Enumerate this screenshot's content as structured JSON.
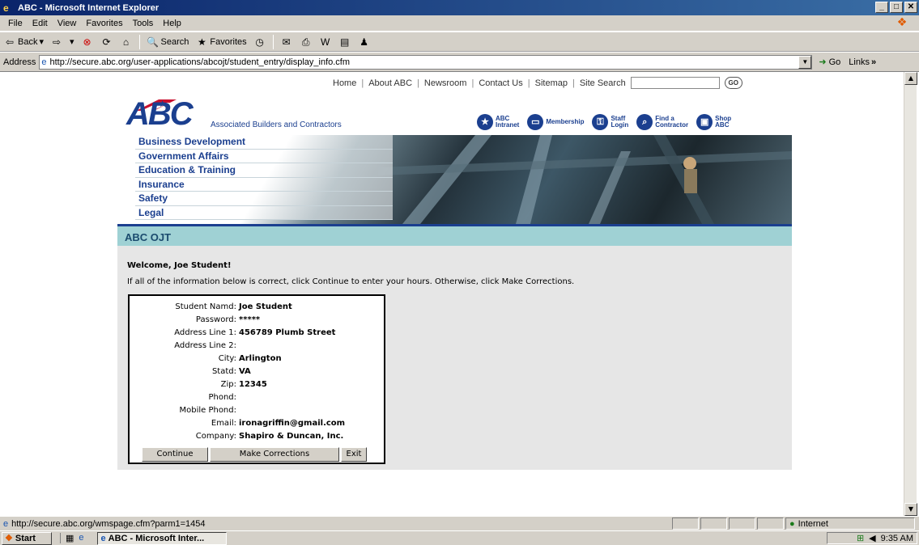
{
  "window": {
    "title": "ABC - Microsoft Internet Explorer",
    "min": "_",
    "max": "□",
    "close": "✕"
  },
  "menu": [
    "File",
    "Edit",
    "View",
    "Favorites",
    "Tools",
    "Help"
  ],
  "toolbar": {
    "back": "Back",
    "search": "Search",
    "favorites": "Favorites"
  },
  "address": {
    "label": "Address",
    "url": "http://secure.abc.org/user-applications/abcojt/student_entry/display_info.cfm",
    "go": "Go",
    "links": "Links"
  },
  "site": {
    "topnav": [
      "Home",
      "About ABC",
      "Newsroom",
      "Contact Us",
      "Sitemap",
      "Site Search"
    ],
    "separator": "|",
    "go_button": "GO",
    "logo": "ABC",
    "tagline": "Associated Builders and Contractors",
    "quicklinks": [
      {
        "line1": "ABC",
        "line2": "Intranet",
        "icon": "star-icon"
      },
      {
        "line1": "Membership",
        "line2": "",
        "icon": "membership-icon"
      },
      {
        "line1": "Staff",
        "line2": "Login",
        "icon": "login-icon"
      },
      {
        "line1": "Find a",
        "line2": "Contractor",
        "icon": "search-icon"
      },
      {
        "line1": "Shop",
        "line2": "ABC",
        "icon": "shop-icon"
      }
    ],
    "nav": [
      "Business Development",
      "Government Affairs",
      "Education & Training",
      "Insurance",
      "Safety",
      "Legal"
    ],
    "section_title": "ABC OJT"
  },
  "page": {
    "welcome": "Welcome, Joe Student!",
    "instructions": "If all of the information below is correct, click Continue to enter your hours. Otherwise, click Make Corrections.",
    "fields": [
      {
        "label": "Student Namd:",
        "value": "Joe Student"
      },
      {
        "label": "Password:",
        "value": "*****"
      },
      {
        "label": "Address Line 1:",
        "value": "456789 Plumb Street"
      },
      {
        "label": "Address Line 2:",
        "value": ""
      },
      {
        "label": "City:",
        "value": "Arlington"
      },
      {
        "label": "Statd:",
        "value": "VA"
      },
      {
        "label": "Zip:",
        "value": "12345"
      },
      {
        "label": "Phond:",
        "value": ""
      },
      {
        "label": "Mobile Phond:",
        "value": ""
      },
      {
        "label": "Email:",
        "value": "ironagriffin@gmail.com"
      },
      {
        "label": "Company:",
        "value": "Shapiro & Duncan, Inc."
      }
    ],
    "buttons": {
      "continue": "Continue",
      "corrections": "Make Corrections",
      "exit": "Exit"
    }
  },
  "status": {
    "text": "http://secure.abc.org/wmspage.cfm?parm1=1454",
    "zone": "Internet"
  },
  "taskbar": {
    "start": "Start",
    "task": "ABC - Microsoft Inter...",
    "clock": "9:35 AM"
  },
  "colors": {
    "brand_blue": "#1b3f8f",
    "section_teal": "#9fd1d4",
    "panel_gray": "#e6e6e6"
  }
}
